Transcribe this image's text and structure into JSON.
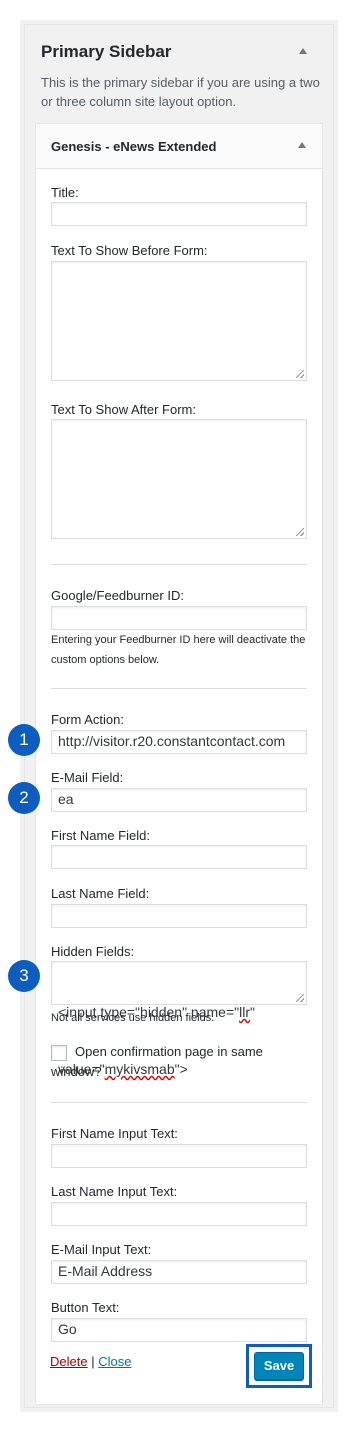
{
  "sidebar": {
    "title": "Primary Sidebar",
    "description": "This is the primary sidebar if you are using a two or three column site layout option."
  },
  "widget": {
    "title": "Genesis - eNews Extended",
    "fields": {
      "title_label": "Title:",
      "title_value": "",
      "before_form_label": "Text To Show Before Form:",
      "before_form_value": "",
      "after_form_label": "Text To Show After Form:",
      "after_form_value": "",
      "feedburner_label": "Google/Feedburner ID:",
      "feedburner_value": "",
      "feedburner_help": "Entering your Feedburner ID here will deactivate the custom options below.",
      "form_action_label": "Form Action:",
      "form_action_value": "http://visitor.r20.constantcontact.com",
      "email_field_label": "E-Mail Field:",
      "email_field_value": "ea",
      "first_name_field_label": "First Name Field:",
      "first_name_field_value": "",
      "last_name_field_label": "Last Name Field:",
      "last_name_field_value": "",
      "hidden_fields_label": "Hidden Fields:",
      "hidden_fields_value_part1": "<input type=\"hidden\" name=\"",
      "hidden_fields_value_part2": "llr",
      "hidden_fields_value_part3": "\"",
      "hidden_fields_value_part4": "value=\"",
      "hidden_fields_value_part5": "mykivsmab",
      "hidden_fields_value_part6": "\">",
      "hidden_fields_help": "Not all services use hidden fields.",
      "open_same_window_label": "Open confirmation page in same window?",
      "open_same_window_checked": false,
      "first_name_input_label": "First Name Input Text:",
      "first_name_input_value": "",
      "last_name_input_label": "Last Name Input Text:",
      "last_name_input_value": "",
      "email_input_label": "E-Mail Input Text:",
      "email_input_value": "E-Mail Address",
      "button_text_label": "Button Text:",
      "button_text_value": "Go"
    },
    "actions": {
      "delete_label": "Delete",
      "separator": "|",
      "close_label": "Close",
      "save_label": "Save"
    }
  },
  "annotations": {
    "badge_1": "1",
    "badge_2": "2",
    "badge_3": "3"
  },
  "colors": {
    "primary_button": "#0085ba",
    "annotation_blue": "#0d5cbf",
    "delete_link": "#aa0000",
    "close_link": "#0073aa"
  },
  "icons": {
    "collapse": "triangle-up-icon",
    "resize": "resize-grip-icon"
  }
}
